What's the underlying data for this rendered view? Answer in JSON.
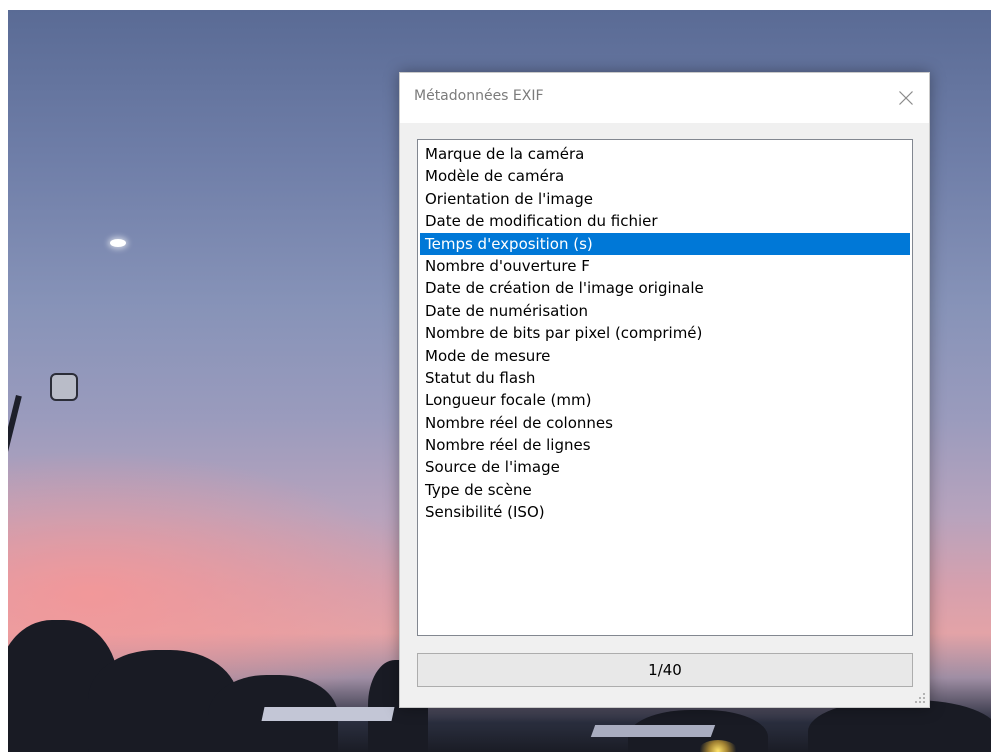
{
  "background": {
    "description_colors": {
      "sky_top": "#5a6b95",
      "sky_mid": "#9a9bbd",
      "sunset": "#e3a3a7",
      "trees": "#191b24"
    }
  },
  "dialog": {
    "title": "Métadonnées EXIF",
    "close_icon": "close-icon",
    "list": {
      "items": [
        "Marque de la caméra",
        "Modèle de caméra",
        "Orientation de l'image",
        "Date de modification du fichier",
        "Temps d'exposition (s)",
        "Nombre d'ouverture F",
        "Date de création de l'image originale",
        "Date de numérisation",
        "Nombre de bits par pixel (comprimé)",
        "Mode de mesure",
        "Statut du flash",
        "Longueur focale (mm)",
        "Nombre réel de colonnes",
        "Nombre réel de lignes",
        "Source de l'image",
        "Type de scène",
        "Sensibilité (ISO)"
      ],
      "selected_index": 4,
      "selection_color": "#0078d7"
    },
    "value": "1/40",
    "resize_grip_icon": "resize-grip-icon"
  }
}
